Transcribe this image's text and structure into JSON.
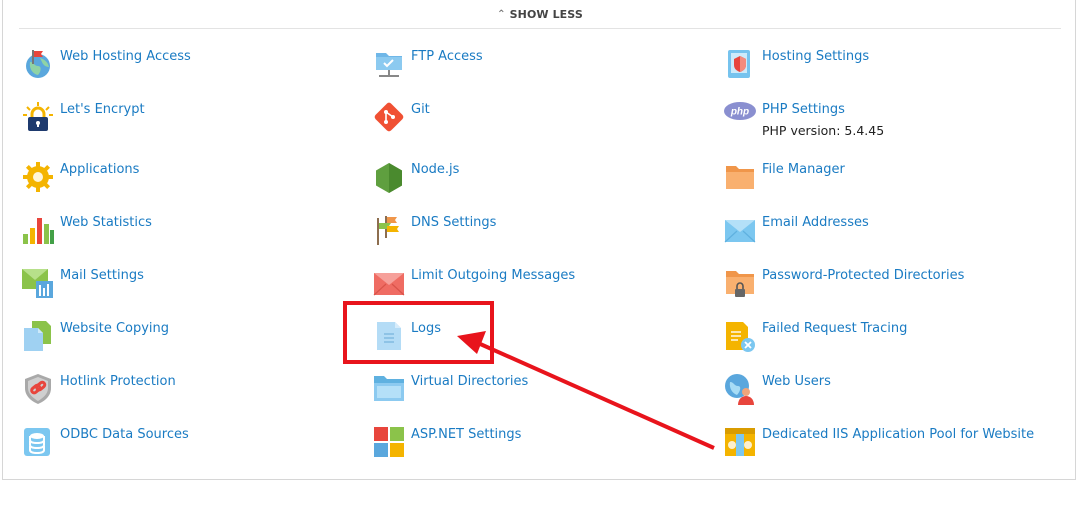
{
  "toggle": {
    "label": "SHOW LESS",
    "icon": "chevron-up-icon"
  },
  "items": [
    {
      "label": "Web Hosting Access",
      "icon": "globe-flag-icon"
    },
    {
      "label": "FTP Access",
      "icon": "ftp-folder-icon"
    },
    {
      "label": "Hosting Settings",
      "icon": "hosting-settings-icon"
    },
    {
      "label": "Let's Encrypt",
      "icon": "lock-icon"
    },
    {
      "label": "Git",
      "icon": "git-icon"
    },
    {
      "label": "PHP Settings",
      "icon": "php-icon",
      "sub": "PHP version: 5.4.45"
    },
    {
      "label": "Applications",
      "icon": "gear-icon"
    },
    {
      "label": "Node.js",
      "icon": "nodejs-icon"
    },
    {
      "label": "File Manager",
      "icon": "folder-icon"
    },
    {
      "label": "Web Statistics",
      "icon": "bar-chart-icon"
    },
    {
      "label": "DNS Settings",
      "icon": "dns-flags-icon"
    },
    {
      "label": "Email Addresses",
      "icon": "envelope-icon"
    },
    {
      "label": "Mail Settings",
      "icon": "mail-settings-icon"
    },
    {
      "label": "Limit Outgoing Messages",
      "icon": "red-envelope-icon"
    },
    {
      "label": "Password-Protected Directories",
      "icon": "locked-folder-icon"
    },
    {
      "label": "Website Copying",
      "icon": "copy-pages-icon"
    },
    {
      "label": "Logs",
      "icon": "log-document-icon"
    },
    {
      "label": "Failed Request Tracing",
      "icon": "failed-request-icon"
    },
    {
      "label": "Hotlink Protection",
      "icon": "hotlink-shield-icon"
    },
    {
      "label": "Virtual Directories",
      "icon": "virtual-folder-icon"
    },
    {
      "label": "Web Users",
      "icon": "web-users-icon"
    },
    {
      "label": "ODBC Data Sources",
      "icon": "database-icon"
    },
    {
      "label": "ASP.NET Settings",
      "icon": "aspnet-windows-icon"
    },
    {
      "label": "Dedicated IIS Application Pool for Website",
      "icon": "iis-pool-icon"
    }
  ],
  "annotation": {
    "highlight_color": "#e8141c",
    "highlighted_item": "Logs"
  }
}
